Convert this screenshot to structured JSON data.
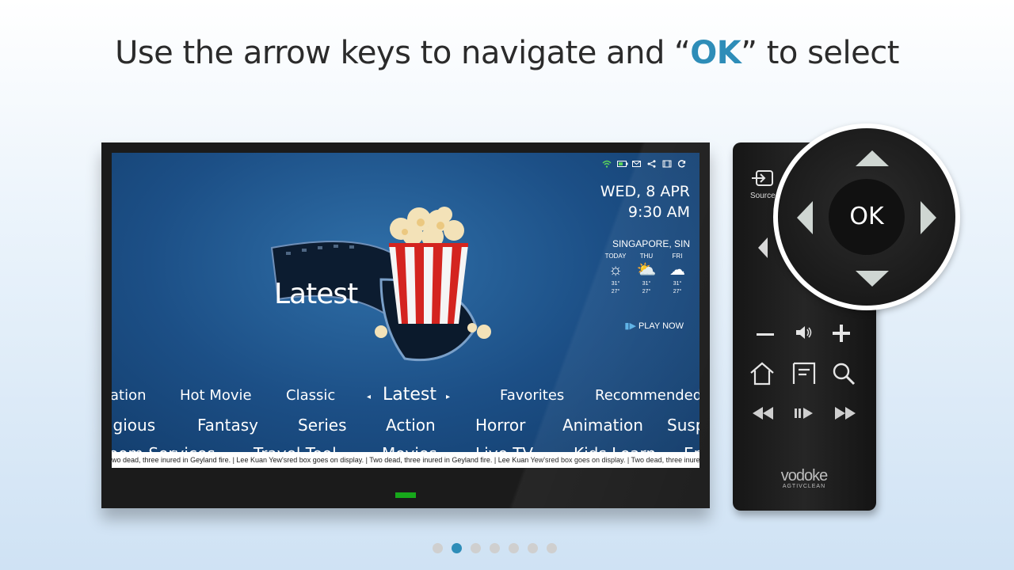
{
  "headline": {
    "before": "Use the arrow keys to navigate and “",
    "highlight": "OK",
    "after": "” to select"
  },
  "colors": {
    "accent": "#2e8db8",
    "screen_bg": "#1c4f86",
    "led": "#17a81b"
  },
  "tv": {
    "status_icons": [
      "wifi-icon",
      "battery-icon",
      "mail-icon",
      "share-icon",
      "film-icon",
      "refresh-icon"
    ],
    "date": "WED, 8 APR",
    "time": "9:30 AM",
    "weather": {
      "city": "SINGAPORE, SIN",
      "days": [
        {
          "label": "TODAY",
          "icon": "sun-icon",
          "high": "31°",
          "low": "27°"
        },
        {
          "label": "THU",
          "icon": "partly-cloudy-icon",
          "high": "31°",
          "low": "27°"
        },
        {
          "label": "FRI",
          "icon": "rain-icon",
          "high": "31°",
          "low": "27°"
        }
      ]
    },
    "play_now": "PLAY NOW",
    "hero_label": "Latest",
    "menu": {
      "row1": [
        "ation",
        "Hot Movie",
        "Classic",
        "Latest",
        "Favorites",
        "Recommended"
      ],
      "row2": [
        "igious",
        "Fantasy",
        "Series",
        "Action",
        "Horror",
        "Animation",
        "Susp"
      ],
      "row3": [
        "oom Services",
        "Travel Tool",
        "Movies",
        "Live TV",
        "Kids Learn",
        "En"
      ]
    },
    "ticker": "wo dead, three inured in Geyland fire. | Lee Kuan Yew'sred box goes on display. |  Two dead, three inured in Geyland fire. | Lee Kuan Yew'sred box goes on display. |  Two dead, three inured in Geyland fire. | Lee Kuan Yew'sred box goes on display. |  Two dead, three inured in Ge"
  },
  "remote": {
    "source_label": "Source",
    "ok_label": "OK",
    "brand": "vodoke",
    "brand_sub": "AGTIVCLEAN"
  },
  "pagination": {
    "total": 7,
    "active_index": 1
  }
}
